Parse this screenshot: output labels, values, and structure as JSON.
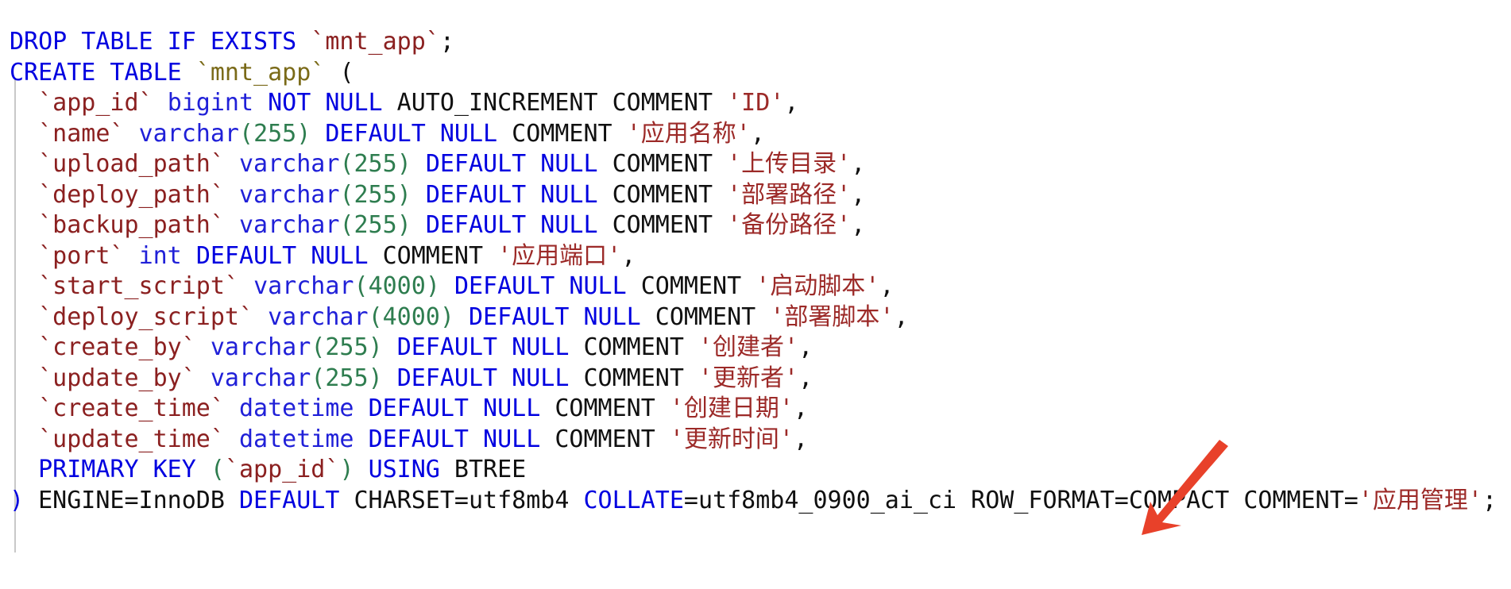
{
  "document": {
    "kind": "sql-ddl-snippet",
    "language": "SQL",
    "table": "mnt_app",
    "background_color": "#ffffff",
    "colors": {
      "keyword": "#0000e0",
      "type": "#2020d8",
      "identifier": "#8b2020",
      "table_name": "#7a6a18",
      "number": "#2e7d4f",
      "paren": "#2e7d4f",
      "plain": "#101010",
      "string": "#9c2a28",
      "indent_guide": "#c8c8c8",
      "annotation_arrow": "#e8412a"
    }
  },
  "code": {
    "lines": [
      {
        "n": 1,
        "text": "DROP TABLE IF EXISTS `mnt_app`;",
        "tokens": [
          {
            "t": "DROP TABLE IF EXISTS",
            "c": "kw"
          },
          {
            "t": " ",
            "c": "plain"
          },
          {
            "t": "`mnt_app`",
            "c": "ident"
          },
          {
            "t": ";",
            "c": "plain"
          }
        ]
      },
      {
        "n": 2,
        "text": "CREATE TABLE `mnt_app` (",
        "tokens": [
          {
            "t": "CREATE TABLE",
            "c": "kw"
          },
          {
            "t": " ",
            "c": "plain"
          },
          {
            "t": "`mnt_app`",
            "c": "tblname"
          },
          {
            "t": " ",
            "c": "plain"
          },
          {
            "t": "(",
            "c": "plain"
          }
        ]
      },
      {
        "n": 3,
        "text": "  `app_id` bigint NOT NULL AUTO_INCREMENT COMMENT 'ID',",
        "tokens": [
          {
            "t": "  ",
            "c": "plain"
          },
          {
            "t": "`app_id`",
            "c": "ident"
          },
          {
            "t": " ",
            "c": "plain"
          },
          {
            "t": "bigint",
            "c": "type"
          },
          {
            "t": " ",
            "c": "plain"
          },
          {
            "t": "NOT NULL",
            "c": "kw"
          },
          {
            "t": " AUTO_INCREMENT COMMENT ",
            "c": "plain"
          },
          {
            "t": "'ID'",
            "c": "str"
          },
          {
            "t": ",",
            "c": "plain"
          }
        ]
      },
      {
        "n": 4,
        "text": "  `name` varchar(255) DEFAULT NULL COMMENT '应用名称',",
        "tokens": [
          {
            "t": "  ",
            "c": "plain"
          },
          {
            "t": "`name`",
            "c": "ident"
          },
          {
            "t": " ",
            "c": "plain"
          },
          {
            "t": "varchar",
            "c": "type"
          },
          {
            "t": "(",
            "c": "paren"
          },
          {
            "t": "255",
            "c": "num"
          },
          {
            "t": ")",
            "c": "paren"
          },
          {
            "t": " ",
            "c": "plain"
          },
          {
            "t": "DEFAULT NULL",
            "c": "kw"
          },
          {
            "t": " COMMENT ",
            "c": "plain"
          },
          {
            "t": "'应用名称'",
            "c": "str"
          },
          {
            "t": ",",
            "c": "plain"
          }
        ]
      },
      {
        "n": 5,
        "text": "  `upload_path` varchar(255) DEFAULT NULL COMMENT '上传目录',",
        "tokens": [
          {
            "t": "  ",
            "c": "plain"
          },
          {
            "t": "`upload_path`",
            "c": "ident"
          },
          {
            "t": " ",
            "c": "plain"
          },
          {
            "t": "varchar",
            "c": "type"
          },
          {
            "t": "(",
            "c": "paren"
          },
          {
            "t": "255",
            "c": "num"
          },
          {
            "t": ")",
            "c": "paren"
          },
          {
            "t": " ",
            "c": "plain"
          },
          {
            "t": "DEFAULT NULL",
            "c": "kw"
          },
          {
            "t": " COMMENT ",
            "c": "plain"
          },
          {
            "t": "'上传目录'",
            "c": "str"
          },
          {
            "t": ",",
            "c": "plain"
          }
        ]
      },
      {
        "n": 6,
        "text": "  `deploy_path` varchar(255) DEFAULT NULL COMMENT '部署路径',",
        "tokens": [
          {
            "t": "  ",
            "c": "plain"
          },
          {
            "t": "`deploy_path`",
            "c": "ident"
          },
          {
            "t": " ",
            "c": "plain"
          },
          {
            "t": "varchar",
            "c": "type"
          },
          {
            "t": "(",
            "c": "paren"
          },
          {
            "t": "255",
            "c": "num"
          },
          {
            "t": ")",
            "c": "paren"
          },
          {
            "t": " ",
            "c": "plain"
          },
          {
            "t": "DEFAULT NULL",
            "c": "kw"
          },
          {
            "t": " COMMENT ",
            "c": "plain"
          },
          {
            "t": "'部署路径'",
            "c": "str"
          },
          {
            "t": ",",
            "c": "plain"
          }
        ]
      },
      {
        "n": 7,
        "text": "  `backup_path` varchar(255) DEFAULT NULL COMMENT '备份路径',",
        "tokens": [
          {
            "t": "  ",
            "c": "plain"
          },
          {
            "t": "`backup_path`",
            "c": "ident"
          },
          {
            "t": " ",
            "c": "plain"
          },
          {
            "t": "varchar",
            "c": "type"
          },
          {
            "t": "(",
            "c": "paren"
          },
          {
            "t": "255",
            "c": "num"
          },
          {
            "t": ")",
            "c": "paren"
          },
          {
            "t": " ",
            "c": "plain"
          },
          {
            "t": "DEFAULT NULL",
            "c": "kw"
          },
          {
            "t": " COMMENT ",
            "c": "plain"
          },
          {
            "t": "'备份路径'",
            "c": "str"
          },
          {
            "t": ",",
            "c": "plain"
          }
        ]
      },
      {
        "n": 8,
        "text": "  `port` int DEFAULT NULL COMMENT '应用端口',",
        "tokens": [
          {
            "t": "  ",
            "c": "plain"
          },
          {
            "t": "`port`",
            "c": "ident"
          },
          {
            "t": " ",
            "c": "plain"
          },
          {
            "t": "int",
            "c": "type"
          },
          {
            "t": " ",
            "c": "plain"
          },
          {
            "t": "DEFAULT NULL",
            "c": "kw"
          },
          {
            "t": " COMMENT ",
            "c": "plain"
          },
          {
            "t": "'应用端口'",
            "c": "str"
          },
          {
            "t": ",",
            "c": "plain"
          }
        ]
      },
      {
        "n": 9,
        "text": "  `start_script` varchar(4000) DEFAULT NULL COMMENT '启动脚本',",
        "tokens": [
          {
            "t": "  ",
            "c": "plain"
          },
          {
            "t": "`start_script`",
            "c": "ident"
          },
          {
            "t": " ",
            "c": "plain"
          },
          {
            "t": "varchar",
            "c": "type"
          },
          {
            "t": "(",
            "c": "paren"
          },
          {
            "t": "4000",
            "c": "num"
          },
          {
            "t": ")",
            "c": "paren"
          },
          {
            "t": " ",
            "c": "plain"
          },
          {
            "t": "DEFAULT NULL",
            "c": "kw"
          },
          {
            "t": " COMMENT ",
            "c": "plain"
          },
          {
            "t": "'启动脚本'",
            "c": "str"
          },
          {
            "t": ",",
            "c": "plain"
          }
        ]
      },
      {
        "n": 10,
        "text": "  `deploy_script` varchar(4000) DEFAULT NULL COMMENT '部署脚本',",
        "tokens": [
          {
            "t": "  ",
            "c": "plain"
          },
          {
            "t": "`deploy_script`",
            "c": "ident"
          },
          {
            "t": " ",
            "c": "plain"
          },
          {
            "t": "varchar",
            "c": "type"
          },
          {
            "t": "(",
            "c": "paren"
          },
          {
            "t": "4000",
            "c": "num"
          },
          {
            "t": ")",
            "c": "paren"
          },
          {
            "t": " ",
            "c": "plain"
          },
          {
            "t": "DEFAULT NULL",
            "c": "kw"
          },
          {
            "t": " COMMENT ",
            "c": "plain"
          },
          {
            "t": "'部署脚本'",
            "c": "str"
          },
          {
            "t": ",",
            "c": "plain"
          }
        ]
      },
      {
        "n": 11,
        "text": "  `create_by` varchar(255) DEFAULT NULL COMMENT '创建者',",
        "tokens": [
          {
            "t": "  ",
            "c": "plain"
          },
          {
            "t": "`create_by`",
            "c": "ident"
          },
          {
            "t": " ",
            "c": "plain"
          },
          {
            "t": "varchar",
            "c": "type"
          },
          {
            "t": "(",
            "c": "paren"
          },
          {
            "t": "255",
            "c": "num"
          },
          {
            "t": ")",
            "c": "paren"
          },
          {
            "t": " ",
            "c": "plain"
          },
          {
            "t": "DEFAULT NULL",
            "c": "kw"
          },
          {
            "t": " COMMENT ",
            "c": "plain"
          },
          {
            "t": "'创建者'",
            "c": "str"
          },
          {
            "t": ",",
            "c": "plain"
          }
        ]
      },
      {
        "n": 12,
        "text": "  `update_by` varchar(255) DEFAULT NULL COMMENT '更新者',",
        "tokens": [
          {
            "t": "  ",
            "c": "plain"
          },
          {
            "t": "`update_by`",
            "c": "ident"
          },
          {
            "t": " ",
            "c": "plain"
          },
          {
            "t": "varchar",
            "c": "type"
          },
          {
            "t": "(",
            "c": "paren"
          },
          {
            "t": "255",
            "c": "num"
          },
          {
            "t": ")",
            "c": "paren"
          },
          {
            "t": " ",
            "c": "plain"
          },
          {
            "t": "DEFAULT NULL",
            "c": "kw"
          },
          {
            "t": " COMMENT ",
            "c": "plain"
          },
          {
            "t": "'更新者'",
            "c": "str"
          },
          {
            "t": ",",
            "c": "plain"
          }
        ]
      },
      {
        "n": 13,
        "text": "  `create_time` datetime DEFAULT NULL COMMENT '创建日期',",
        "tokens": [
          {
            "t": "  ",
            "c": "plain"
          },
          {
            "t": "`create_time`",
            "c": "ident"
          },
          {
            "t": " ",
            "c": "plain"
          },
          {
            "t": "datetime",
            "c": "type"
          },
          {
            "t": " ",
            "c": "plain"
          },
          {
            "t": "DEFAULT NULL",
            "c": "kw"
          },
          {
            "t": " COMMENT ",
            "c": "plain"
          },
          {
            "t": "'创建日期'",
            "c": "str"
          },
          {
            "t": ",",
            "c": "plain"
          }
        ]
      },
      {
        "n": 14,
        "text": "  `update_time` datetime DEFAULT NULL COMMENT '更新时间',",
        "tokens": [
          {
            "t": "  ",
            "c": "plain"
          },
          {
            "t": "`update_time`",
            "c": "ident"
          },
          {
            "t": " ",
            "c": "plain"
          },
          {
            "t": "datetime",
            "c": "type"
          },
          {
            "t": " ",
            "c": "plain"
          },
          {
            "t": "DEFAULT NULL",
            "c": "kw"
          },
          {
            "t": " COMMENT ",
            "c": "plain"
          },
          {
            "t": "'更新时间'",
            "c": "str"
          },
          {
            "t": ",",
            "c": "plain"
          }
        ]
      },
      {
        "n": 15,
        "text": "  PRIMARY KEY (`app_id`) USING BTREE",
        "tokens": [
          {
            "t": "  ",
            "c": "plain"
          },
          {
            "t": "PRIMARY KEY",
            "c": "kw"
          },
          {
            "t": " ",
            "c": "plain"
          },
          {
            "t": "(",
            "c": "paren"
          },
          {
            "t": "`app_id`",
            "c": "ident"
          },
          {
            "t": ")",
            "c": "paren"
          },
          {
            "t": " ",
            "c": "plain"
          },
          {
            "t": "USING",
            "c": "kw"
          },
          {
            "t": " BTREE",
            "c": "plain"
          }
        ]
      },
      {
        "n": 16,
        "text": ") ENGINE=InnoDB DEFAULT CHARSET=utf8mb4 COLLATE=utf8mb4_0900_ai_ci ROW_FORMAT=COMPACT COMMENT='应用管理';",
        "tokens": [
          {
            "t": ")",
            "c": "bparen"
          },
          {
            "t": " ENGINE=InnoDB ",
            "c": "plain"
          },
          {
            "t": "DEFAULT",
            "c": "kw"
          },
          {
            "t": " CHARSET=utf8mb4 ",
            "c": "plain"
          },
          {
            "t": "COLLATE",
            "c": "kw"
          },
          {
            "t": "=utf8mb4_0900_ai_ci ROW_FORMAT=COMPACT COMMENT=",
            "c": "plain"
          },
          {
            "t": "'应用管理'",
            "c": "str"
          },
          {
            "t": ";",
            "c": "plain"
          }
        ]
      }
    ]
  },
  "annotation": {
    "arrow": {
      "name": "red-arrow",
      "color": "#e8412a",
      "direction": "down-left",
      "points_at_line": 16
    }
  }
}
